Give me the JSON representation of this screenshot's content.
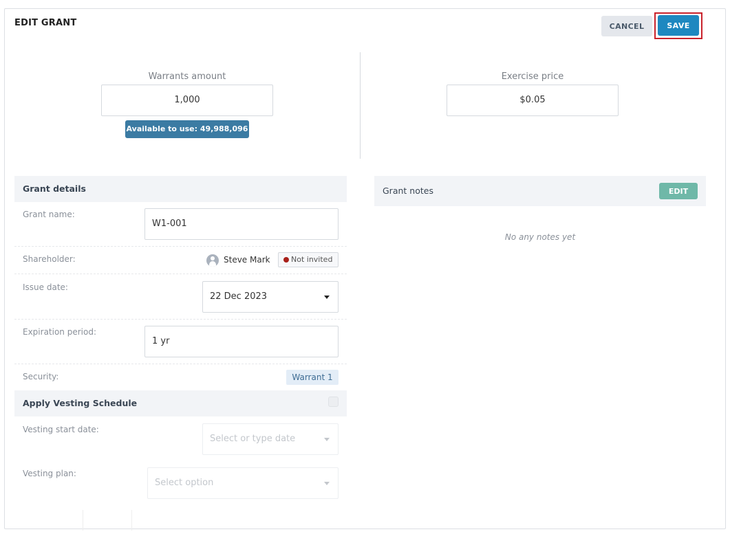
{
  "header": {
    "title": "EDIT GRANT",
    "cancel_label": "CANCEL",
    "save_label": "SAVE"
  },
  "amounts": {
    "warrants_label": "Warrants amount",
    "warrants_value": "1,000",
    "available_badge": "Available to use: 49,988,096",
    "exercise_label": "Exercise price",
    "exercise_value": "$0.05"
  },
  "grant_details": {
    "section_title": "Grant details",
    "grant_name_label": "Grant name:",
    "grant_name_value": "W1-001",
    "shareholder_label": "Shareholder:",
    "shareholder_name": "Steve Mark",
    "shareholder_status": "Not invited",
    "issue_date_label": "Issue date:",
    "issue_date_value": "22 Dec 2023",
    "expiration_label": "Expiration period:",
    "expiration_value": "1 yr",
    "security_label": "Security:",
    "security_value": "Warrant 1"
  },
  "vesting": {
    "section_title": "Apply Vesting Schedule",
    "checked": false,
    "start_date_label": "Vesting start date:",
    "start_date_placeholder": "Select or type date",
    "plan_label": "Vesting plan:",
    "plan_placeholder": "Select option"
  },
  "notes": {
    "section_title": "Grant notes",
    "edit_label": "EDIT",
    "empty_text": "No any notes yet"
  },
  "colors": {
    "save_button": "#1e88c0",
    "save_highlight": "#c9222b",
    "edit_button": "#6fb8a8",
    "badge": "#3b7ba3",
    "status_dot": "#a8201a"
  }
}
